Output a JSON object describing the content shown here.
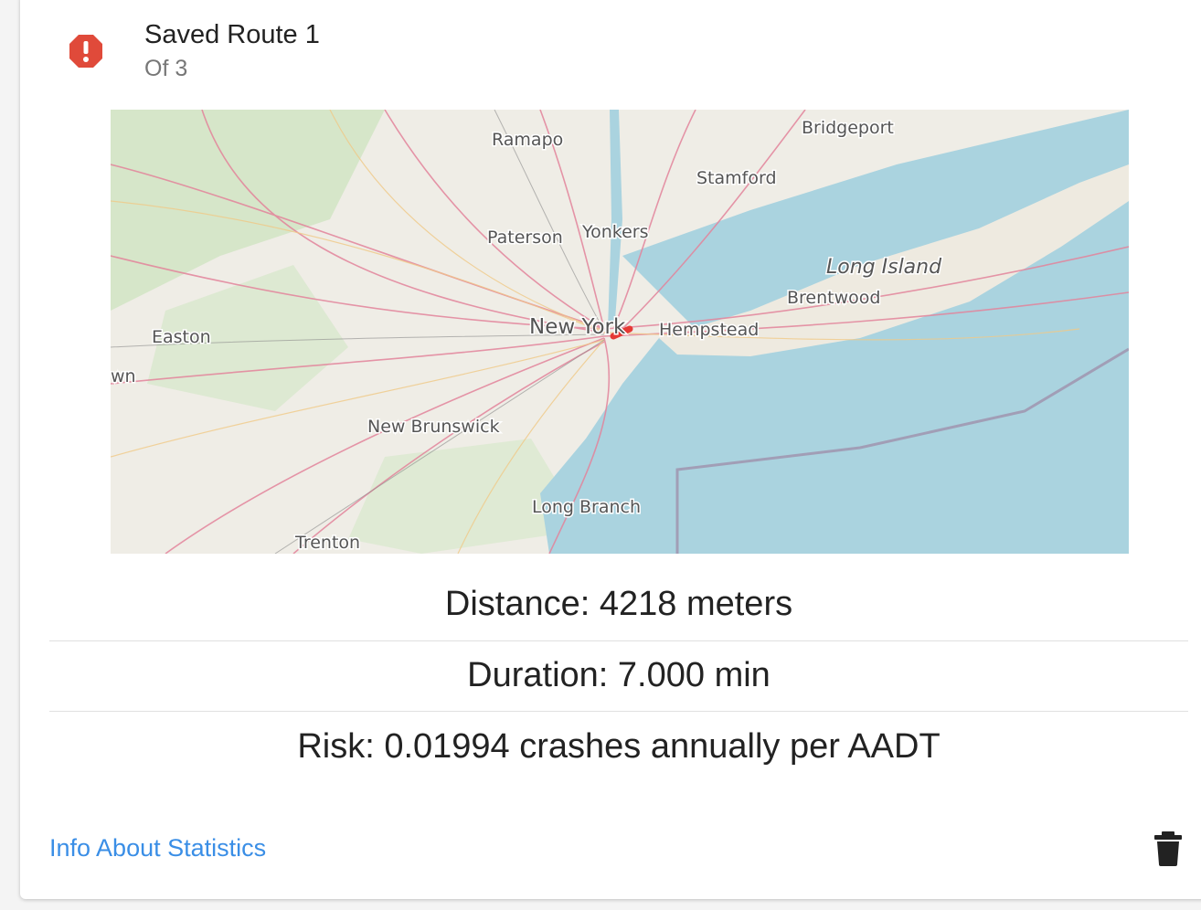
{
  "route": {
    "title": "Saved Route 1",
    "subtitle": "Of 3",
    "status_icon": "alert-octagon-icon"
  },
  "map": {
    "labels": [
      "Bridgeport",
      "Ramapo",
      "Stamford",
      "Yonkers",
      "Paterson",
      "Long Island",
      "Brentwood",
      "New York",
      "Hempstead",
      "Easton",
      "wn",
      "New Brunswick",
      "Long Branch",
      "Trenton"
    ],
    "colors": {
      "water": "#aad3df",
      "land": "#efede6",
      "route": "#e53935"
    }
  },
  "stats": {
    "distance": "Distance: 4218 meters",
    "duration": "Duration: 7.000 min",
    "risk": "Risk: 0.01994 crashes annually per AADT"
  },
  "footer": {
    "info_link": "Info About Statistics",
    "delete_icon": "trash-icon"
  },
  "colors": {
    "alert": "#e04a3a",
    "link": "#3a8ee6"
  }
}
